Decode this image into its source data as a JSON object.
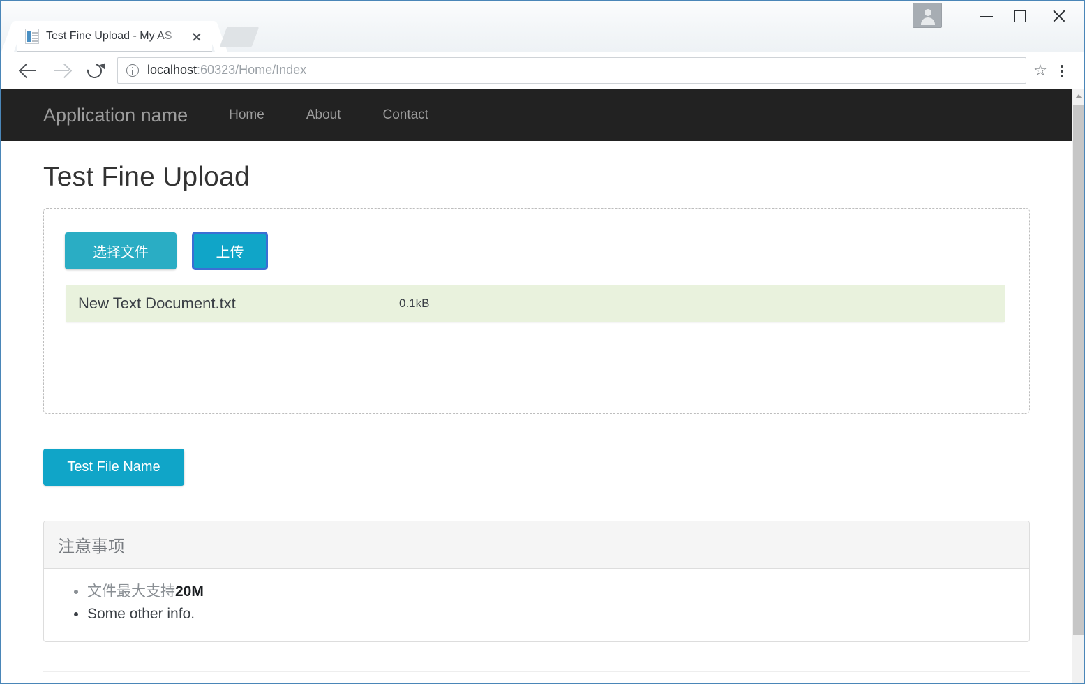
{
  "browser": {
    "tab": {
      "title": "Test Fine Upload - My AS",
      "favicon_name": "document-favicon",
      "close_label": "×"
    },
    "new_tab_label": "",
    "toolbar": {
      "back_label": "",
      "forward_label": "",
      "reload_label": "",
      "url_host": "localhost",
      "url_path": ":60323/Home/Index",
      "star_label": "☆",
      "menu_label": ""
    },
    "window_controls": {
      "profile_label": "",
      "minimize_label": "",
      "maximize_label": "",
      "close_label": ""
    }
  },
  "site_nav": {
    "brand": "Application name",
    "links": [
      {
        "label": "Home"
      },
      {
        "label": "About"
      },
      {
        "label": "Contact"
      }
    ]
  },
  "main": {
    "page_title": "Test Fine Upload",
    "uploader": {
      "select_button_label": "选择文件",
      "upload_button_label": "上传",
      "files": [
        {
          "name": "New Text Document.txt",
          "size": "0.1kB"
        }
      ]
    },
    "test_file_name_button_label": "Test File Name",
    "panel": {
      "title": "注意事项",
      "items": [
        {
          "text": "文件最大支持",
          "strong": "20M",
          "muted": true
        },
        {
          "text": "Some other info.",
          "strong": "",
          "muted": false
        }
      ]
    }
  },
  "colors": {
    "accent": "#10a5c8",
    "accent_light": "#2aadc4",
    "navbar_bg": "#222222",
    "file_row_bg": "#e9f2dd",
    "focus_ring": "#3b6fd4",
    "panel_header_bg": "#f5f5f5"
  }
}
